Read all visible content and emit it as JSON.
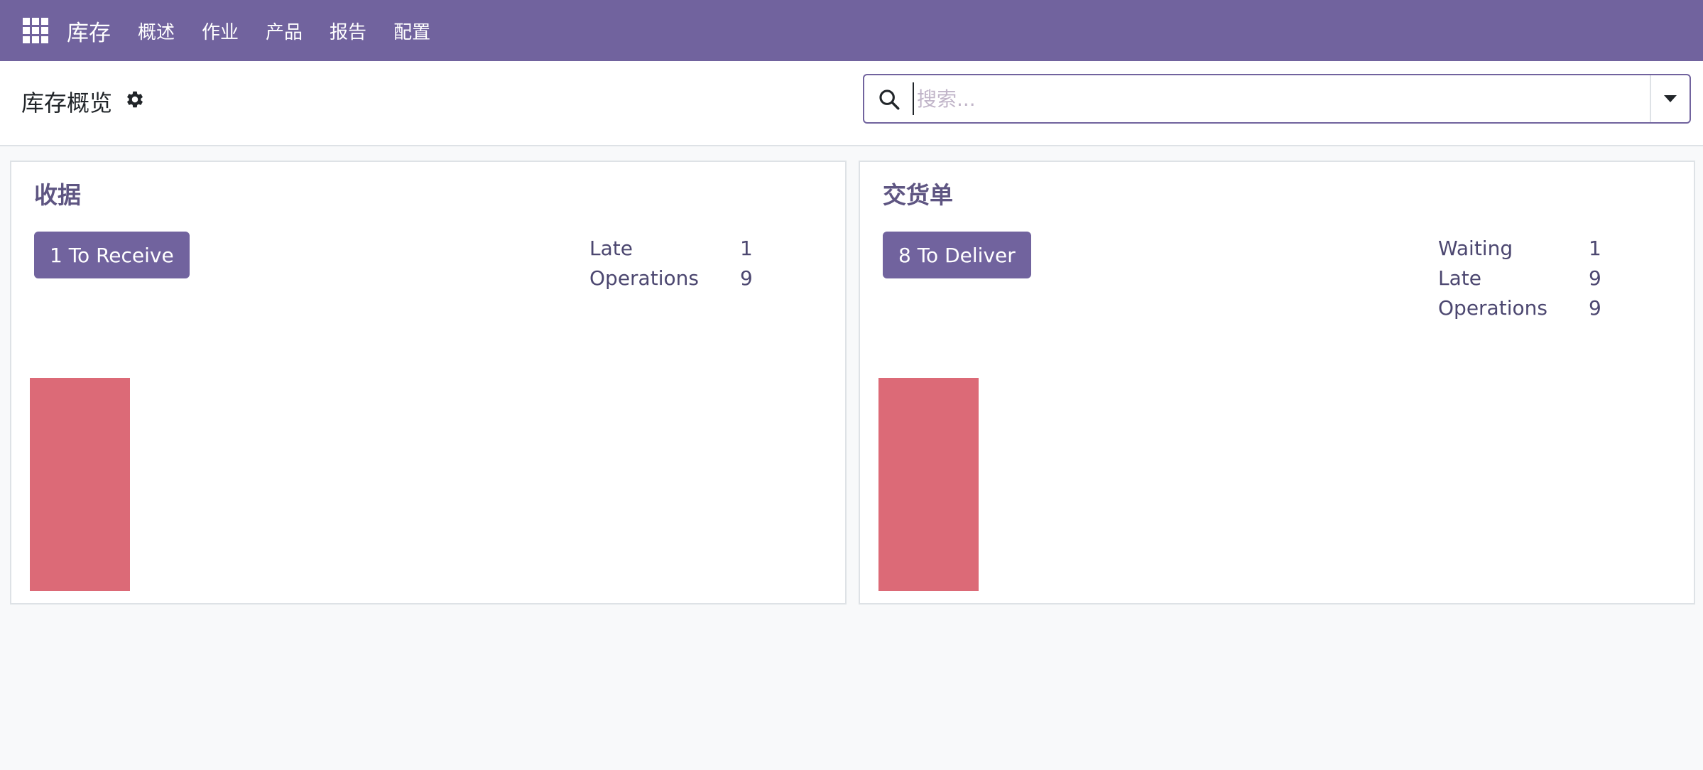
{
  "navbar": {
    "app_name": "库存",
    "menu": [
      "概述",
      "作业",
      "产品",
      "报告",
      "配置"
    ],
    "color": "#71639e"
  },
  "control_panel": {
    "title": "库存概览",
    "search_placeholder": "搜索..."
  },
  "cards": [
    {
      "title": "收据",
      "button_label": "1 To Receive",
      "stats": [
        {
          "label": "Late",
          "value": "1"
        },
        {
          "label": "Operations",
          "value": "9"
        }
      ],
      "graph": {
        "bar_color": "#dc6a77",
        "bar_level": 1.0
      }
    },
    {
      "title": "交货单",
      "button_label": "8 To Deliver",
      "stats": [
        {
          "label": "Waiting",
          "value": "1"
        },
        {
          "label": "Late",
          "value": "9"
        },
        {
          "label": "Operations",
          "value": "9"
        }
      ],
      "graph": {
        "bar_color": "#dc6a77",
        "bar_level": 1.0
      }
    }
  ]
}
